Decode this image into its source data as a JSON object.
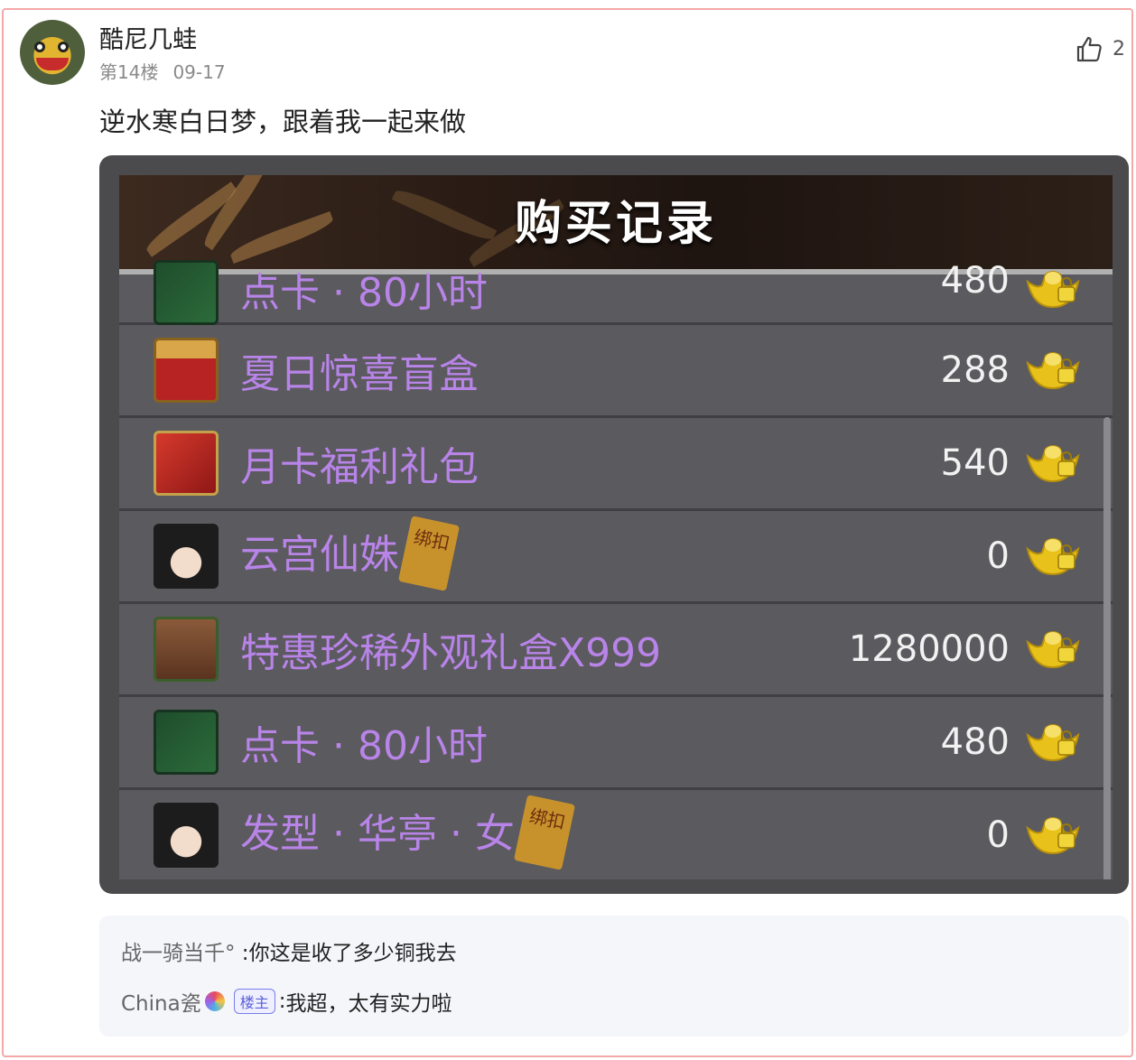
{
  "post": {
    "username": "酷尼几蛙",
    "floor": "第14楼",
    "date": "09-17",
    "like_count": "2",
    "text": "逆水寒白日梦，跟着我一起来做"
  },
  "game": {
    "title": "购买记录",
    "rows": [
      {
        "name": "点卡 · 80小时",
        "price": "480",
        "icon": "time-card-icon",
        "bound": false,
        "partial": true
      },
      {
        "name": "夏日惊喜盲盒",
        "price": "288",
        "icon": "treasure-chest-icon",
        "bound": false
      },
      {
        "name": "月卡福利礼包",
        "price": "540",
        "icon": "gift-box-icon",
        "bound": false
      },
      {
        "name": "云宫仙姝",
        "price": "0",
        "icon": "character-portrait-icon",
        "bound": true
      },
      {
        "name": "特惠珍稀外观礼盒X999",
        "price": "1280000",
        "icon": "appearance-box-icon",
        "bound": false
      },
      {
        "name": "点卡 · 80小时",
        "price": "480",
        "icon": "time-card-icon",
        "bound": false
      },
      {
        "name": "发型 · 华亭 · 女",
        "price": "0",
        "icon": "hairstyle-portrait-icon",
        "bound": true
      }
    ],
    "bound_tag": "绑扣"
  },
  "replies": [
    {
      "who": "战一骑当千°",
      "sep": " :",
      "text": "你这是收了多少铜我去"
    },
    {
      "who": "China瓷",
      "badge": "楼主",
      "sep": ":",
      "text": "我超，太有实力啦"
    }
  ],
  "colors": {
    "frame_border": "#f4a8a8",
    "item_name": "#b884e8",
    "panel_bg": "#58575b",
    "reply_bg": "#f5f6fa"
  }
}
